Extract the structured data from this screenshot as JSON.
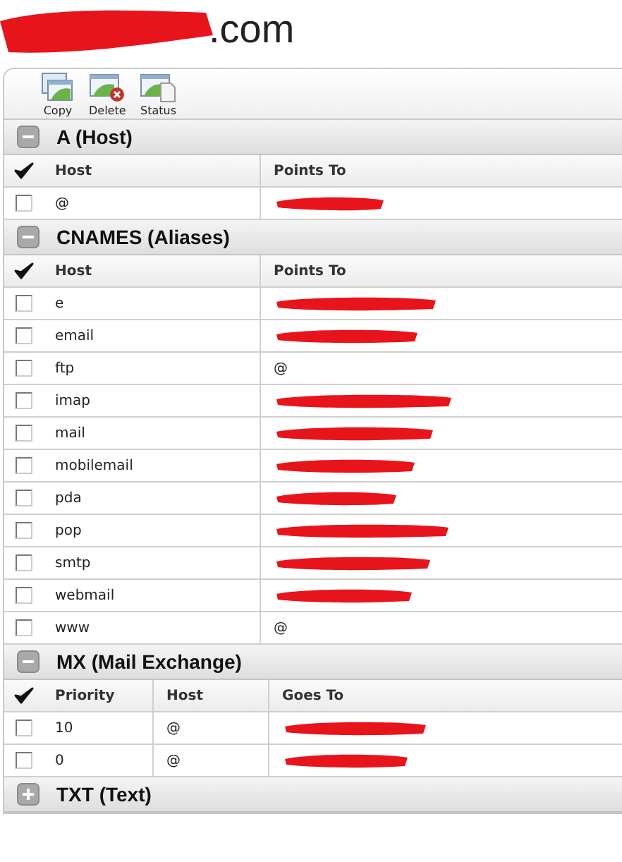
{
  "title": {
    "redacted": true,
    "text": ".com"
  },
  "toolbar": [
    {
      "kind": "copy",
      "label": "Copy"
    },
    {
      "kind": "delete",
      "label": "Delete"
    },
    {
      "kind": "status",
      "label": "Status"
    }
  ],
  "sections": [
    {
      "title": "A (Host)",
      "expanded": true,
      "columns": [
        "Host",
        "Points To"
      ],
      "rows": [
        {
          "checked": false,
          "cells": [
            {
              "text": "@"
            },
            {
              "redacted": true
            }
          ]
        }
      ]
    },
    {
      "title": "CNAMES (Aliases)",
      "expanded": true,
      "columns": [
        "Host",
        "Points To"
      ],
      "rows": [
        {
          "checked": false,
          "cells": [
            {
              "text": "e"
            },
            {
              "redacted": true
            }
          ]
        },
        {
          "checked": false,
          "cells": [
            {
              "text": "email"
            },
            {
              "redacted": true
            }
          ]
        },
        {
          "checked": false,
          "cells": [
            {
              "text": "ftp"
            },
            {
              "text": "@"
            }
          ]
        },
        {
          "checked": false,
          "cells": [
            {
              "text": "imap"
            },
            {
              "redacted": true
            }
          ]
        },
        {
          "checked": false,
          "cells": [
            {
              "text": "mail"
            },
            {
              "redacted": true
            }
          ]
        },
        {
          "checked": false,
          "cells": [
            {
              "text": "mobilemail"
            },
            {
              "redacted": true
            }
          ]
        },
        {
          "checked": false,
          "cells": [
            {
              "text": "pda"
            },
            {
              "redacted": true
            }
          ]
        },
        {
          "checked": false,
          "cells": [
            {
              "text": "pop"
            },
            {
              "redacted": true
            }
          ]
        },
        {
          "checked": false,
          "cells": [
            {
              "text": "smtp"
            },
            {
              "redacted": true
            }
          ]
        },
        {
          "checked": false,
          "cells": [
            {
              "text": "webmail"
            },
            {
              "redacted": true
            }
          ]
        },
        {
          "checked": false,
          "cells": [
            {
              "text": "www"
            },
            {
              "text": "@"
            }
          ]
        }
      ]
    },
    {
      "title": "MX (Mail Exchange)",
      "expanded": true,
      "columns": [
        "Priority",
        "Host",
        "Goes To"
      ],
      "rows": [
        {
          "checked": false,
          "cells": [
            {
              "text": "10"
            },
            {
              "text": "@"
            },
            {
              "redacted": true
            }
          ]
        },
        {
          "checked": false,
          "cells": [
            {
              "text": "0"
            },
            {
              "text": "@"
            },
            {
              "redacted": true
            }
          ]
        }
      ]
    },
    {
      "title": "TXT (Text)",
      "expanded": false
    }
  ]
}
